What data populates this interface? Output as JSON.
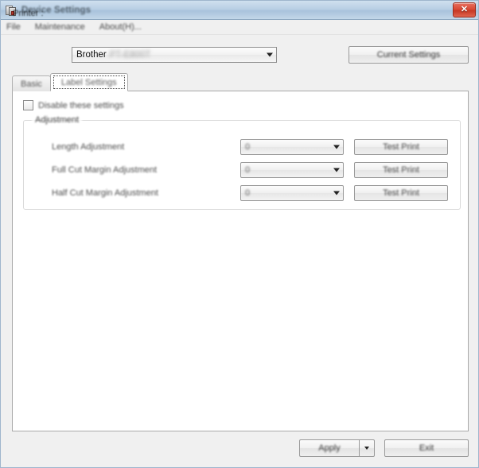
{
  "window": {
    "title": "Device Settings",
    "icon": "printer-icon",
    "close_label": "✕"
  },
  "menubar": {
    "items": [
      {
        "label": "File",
        "mnemonic": "F"
      },
      {
        "label": "Maintenance",
        "mnemonic": "M"
      },
      {
        "label": "About(H)...",
        "mnemonic": "H"
      }
    ]
  },
  "printer": {
    "label": "Printer :",
    "brand": "Brother",
    "model": "PT-E800T",
    "current_settings_label": "Current Settings"
  },
  "tabs": [
    {
      "label": "Basic",
      "active": false
    },
    {
      "label": "Label Settings",
      "active": true
    }
  ],
  "panel": {
    "disable_checkbox": {
      "label": "Disable these settings",
      "checked": false
    },
    "group": {
      "title": "Adjustment",
      "rows": [
        {
          "label": "Length Adjustment",
          "value": "0",
          "button": "Test Print"
        },
        {
          "label": "Full Cut Margin Adjustment",
          "value": "0",
          "button": "Test Print"
        },
        {
          "label": "Half Cut Margin Adjustment",
          "value": "0",
          "button": "Test Print"
        }
      ]
    }
  },
  "footer": {
    "apply_label": "Apply",
    "apply_dropdown": "chevron-down-icon",
    "exit_label": "Exit"
  },
  "colors": {
    "titlebar_start": "#cfe0ef",
    "titlebar_end": "#c3d7e8",
    "close_button": "#d94a36",
    "window_bg": "#f0f0f0",
    "panel_bg": "#ffffff",
    "border": "#a8a8a8"
  }
}
